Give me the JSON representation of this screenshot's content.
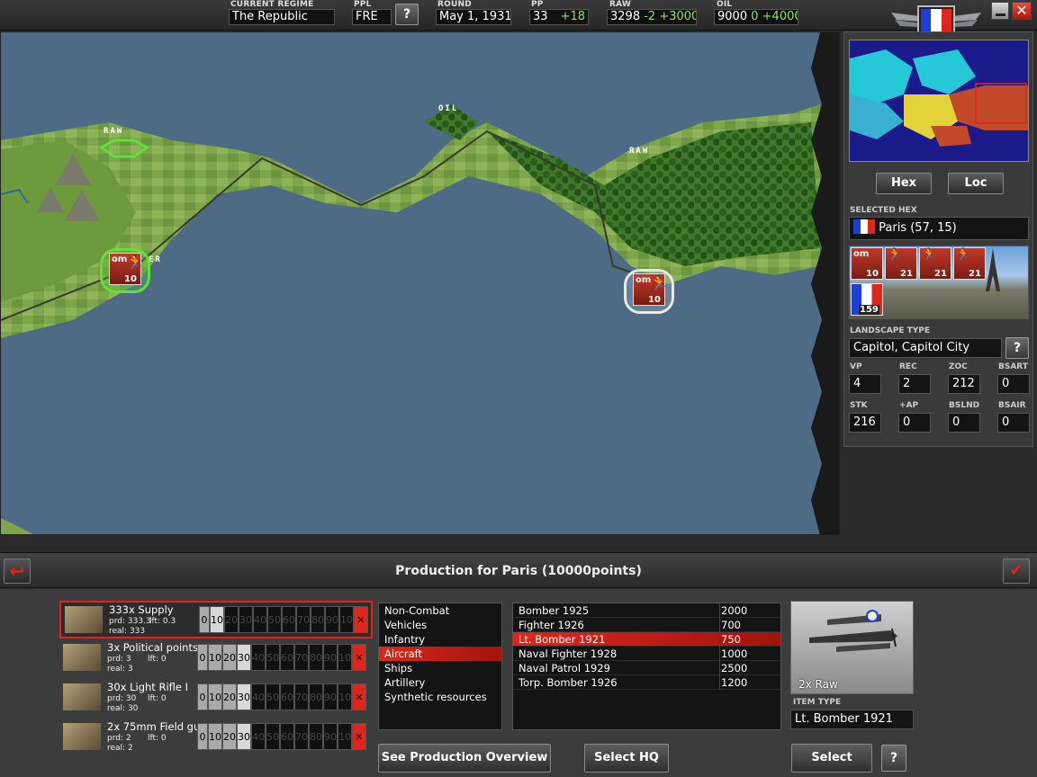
{
  "topbar": {
    "regime_label": "CURRENT REGIME",
    "regime_value": "The Republic",
    "ppl_label": "PPL",
    "ppl_value": "FRE",
    "help": "?",
    "round_label": "ROUND",
    "round_value": "May 1, 1931",
    "pp_label": "PP",
    "pp_value": "33",
    "pp_delta": "+18",
    "raw_label": "RAW",
    "raw_value": "3298",
    "raw_delta1": "-2",
    "raw_delta2": "+3000",
    "oil_label": "OIL",
    "oil_value": "9000",
    "oil_delta1": "0",
    "oil_delta2": "+4000",
    "colors": {
      "bg": "#2b2b2b",
      "accent_red": "#d42a1a",
      "green": "#8fe36a"
    }
  },
  "map": {
    "labels": {
      "raw_1": "RAW",
      "oil": "OIL",
      "raw_2": "RAW",
      "city_part": "ER"
    },
    "units": [
      {
        "id": "unit_left",
        "strength": "10"
      },
      {
        "id": "unit_right",
        "strength": "10"
      }
    ]
  },
  "right_panel": {
    "hex_button": "Hex",
    "loc_button": "Loc",
    "selected_hex_label": "SELECTED HEX",
    "selected_hex_value": "Paris (57, 15)",
    "hex_units": [
      "10",
      "21",
      "21",
      "21",
      "159"
    ],
    "landscape_label": "LANDSCAPE TYPE",
    "landscape_value": "Capitol, Capitol City",
    "help": "?",
    "stats": [
      {
        "label": "VP",
        "value": "4"
      },
      {
        "label": "REC",
        "value": "2"
      },
      {
        "label": "ZOC",
        "value": "212"
      },
      {
        "label": "BSART",
        "value": "0"
      },
      {
        "label": "STK",
        "value": "216"
      },
      {
        "label": "+AP",
        "value": "0"
      },
      {
        "label": "BSLND",
        "value": "0"
      },
      {
        "label": "BSAIR",
        "value": "0"
      }
    ]
  },
  "production": {
    "title": "Production for Paris (10000points)",
    "queue": [
      {
        "name": "333x Supply",
        "prd": "prd: 333.3",
        "lft": "lft: 0.3",
        "real": "real: 333",
        "selected": "10"
      },
      {
        "name": "3x Political points",
        "prd": "prd: 3",
        "lft": "lft: 0",
        "real": "real: 3",
        "selected": "30"
      },
      {
        "name": "30x Light Rifle I",
        "prd": "prd: 30",
        "lft": "lft: 0",
        "real": "real: 30",
        "selected": "30"
      },
      {
        "name": "2x 75mm Field gu",
        "prd": "prd: 2",
        "lft": "lft: 0",
        "real": "real: 2",
        "selected": "30"
      }
    ],
    "segments": [
      "0",
      "10",
      "20",
      "30",
      "40",
      "50",
      "60",
      "70",
      "80",
      "90",
      "100"
    ],
    "categories": [
      "Non-Combat",
      "Vehicles",
      "Infantry",
      "Aircraft",
      "Ships",
      "Artillery",
      "Synthetic resources"
    ],
    "selected_category": "Aircraft",
    "items": [
      {
        "name": "Bomber 1925",
        "cost": "2000"
      },
      {
        "name": "Fighter 1926",
        "cost": "700"
      },
      {
        "name": "Lt. Bomber 1921",
        "cost": "750"
      },
      {
        "name": "Naval Fighter 1928",
        "cost": "1000"
      },
      {
        "name": "Naval Patrol 1929",
        "cost": "2500"
      },
      {
        "name": "Torp. Bomber 1926",
        "cost": "1200"
      }
    ],
    "selected_item": "Lt. Bomber 1921",
    "preview_caption": "2x Raw",
    "item_type_label": "ITEM TYPE",
    "item_type_value": "Lt. Bomber 1921",
    "overview_button": "See Production Overview",
    "select_hq_button": "Select HQ",
    "select_button": "Select",
    "help": "?"
  }
}
